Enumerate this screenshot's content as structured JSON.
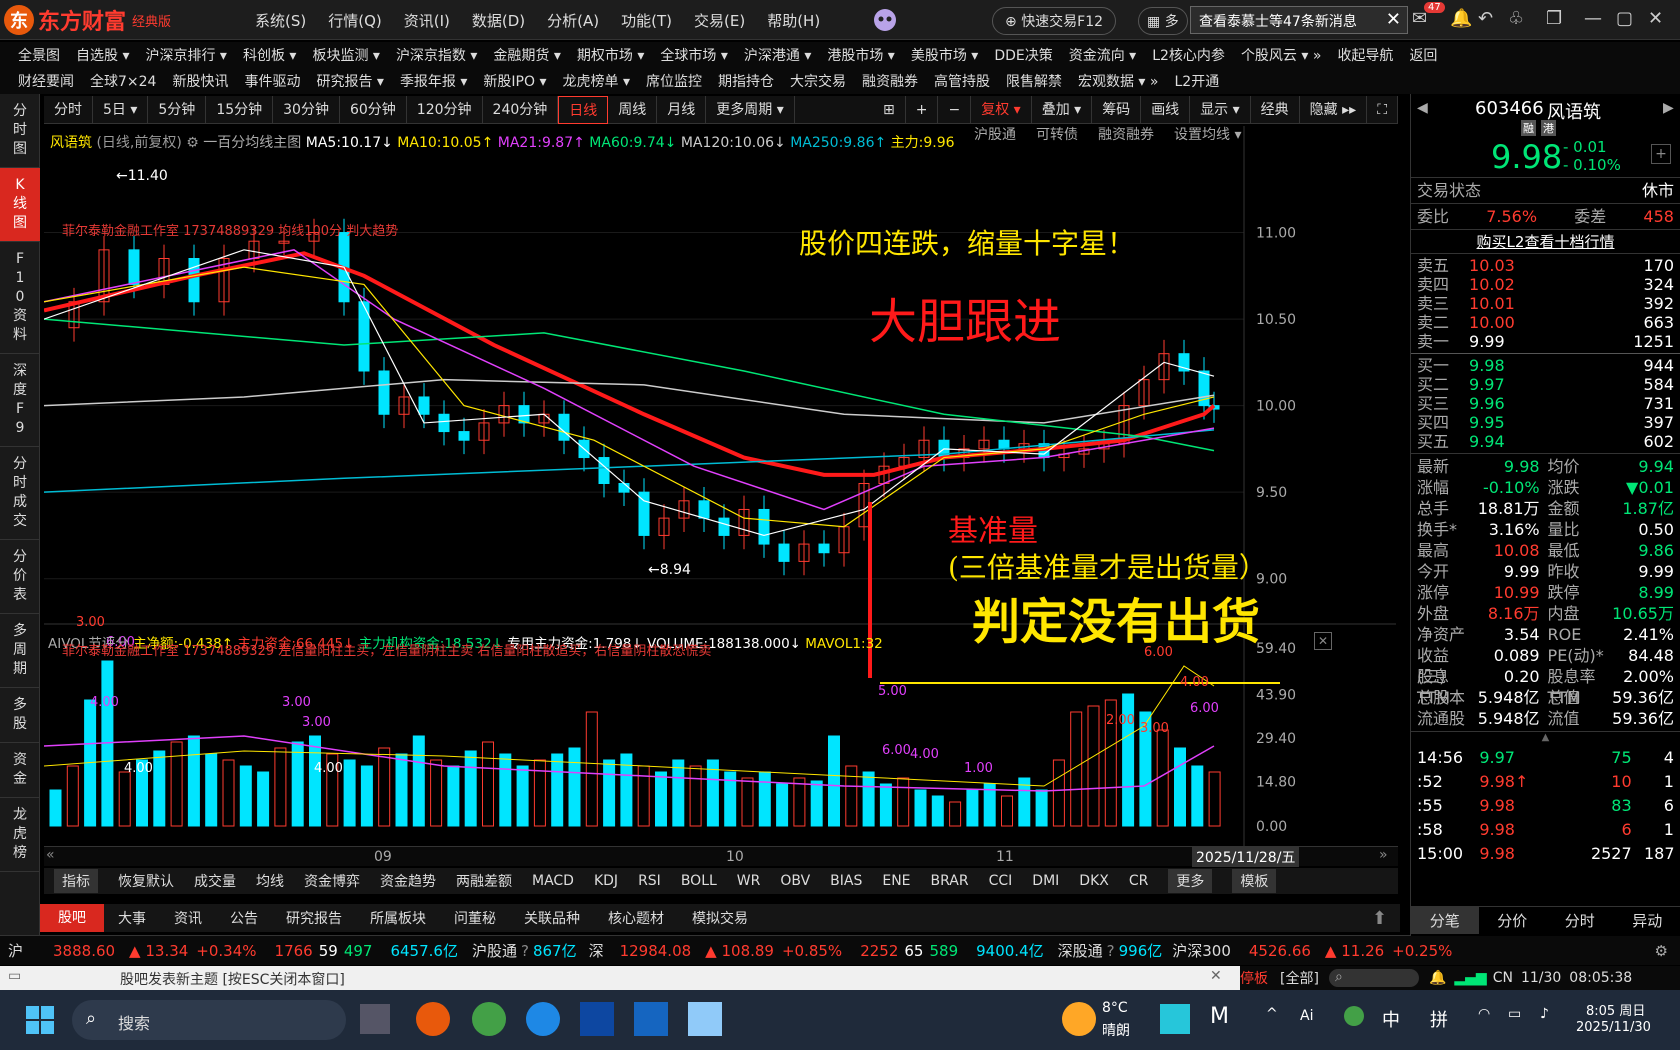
{
  "app": {
    "brand": "东方财富",
    "edition": "经典版"
  },
  "main_menu": [
    "系统(S)",
    "行情(Q)",
    "资讯(I)",
    "数据(D)",
    "分析(A)",
    "功能(T)",
    "交易(E)",
    "帮助(H)"
  ],
  "quick_trade": "快速交易F12",
  "multi_label": "多",
  "news_msg": "查看泰慕士等47条新消息",
  "mail_count": "47",
  "menu_row1": [
    "全景图",
    "自选股 ▾",
    "沪深京排行 ▾",
    "科创板 ▾",
    "板块监测 ▾",
    "沪深京指数 ▾",
    "金融期货 ▾",
    "期权市场 ▾",
    "全球市场 ▾",
    "沪深港通 ▾",
    "港股市场 ▾",
    "美股市场 ▾",
    "DDE决策",
    "资金流向 ▾",
    "L2核心内参",
    "个股风云 ▾ »",
    "收起导航",
    "返回"
  ],
  "menu_row2": [
    "财经要闻",
    "全球7×24",
    "新股快讯",
    "事件驱动",
    "研究报告 ▾",
    "季报年报 ▾",
    "新股IPO ▾",
    "龙虎榜单 ▾",
    "席位监控",
    "期指持仓",
    "大宗交易",
    "融资融券",
    "高管持股",
    "限售解禁",
    "宏观数据 ▾ »",
    "L2开通"
  ],
  "left_sidebar": [
    "分时图",
    "K线图",
    "F10资料",
    "深度F9",
    "分时成交",
    "分价表",
    "多周期",
    "多股",
    "资金",
    "龙虎榜"
  ],
  "period_tabs": [
    "分时",
    "5日 ▾",
    "5分钟",
    "15分钟",
    "30分钟",
    "60分钟",
    "120分钟",
    "240分钟",
    "日线",
    "周线",
    "月线",
    "更多周期 ▾"
  ],
  "period_active": "日线",
  "chart_tools": [
    "⊞",
    "+",
    "−",
    "复权 ▾",
    "叠加 ▾",
    "筹码",
    "画线",
    "显示 ▾",
    "经典",
    "隐藏 ▸▸",
    "⛶"
  ],
  "ma_legend": {
    "stock": "风语筑",
    "mode": "(日线,前复权)",
    "indicator": "一百分均线主图",
    "ma5": "MA5:10.17↓",
    "ma10": "MA10:10.05↑",
    "ma21": "MA21:9.87↑",
    "ma60": "MA60:9.74↓",
    "ma120": "MA120:10.06↓",
    "ma250": "MA250:9.86↑",
    "zhuli": "主力:9.96",
    "links": [
      "沪股通",
      "可转债",
      "融资融券",
      "设置均线 ▾"
    ]
  },
  "studio_line_top": "菲尔泰勒金融工作室 17374889329 均线100分 判大趋势",
  "studio_line_vol": "菲尔泰勒金融工作室 17374889329  左信量阳柱主买，左信量阴柱主卖  右信量阳柱散追买，右信量阴柱散恐慌卖",
  "annotations": {
    "a1": "股价四连跌，缩量十字星！",
    "a2": "大胆跟进",
    "a3": "基准量",
    "a4": "(三倍基准量才是出货量）",
    "a5": "判定没有出货"
  },
  "price_marks": {
    "high": "←11.40",
    "low": "←8.94"
  },
  "price_axis": [
    "11.00",
    "10.50",
    "10.00",
    "9.50",
    "9.00"
  ],
  "vol_axis": [
    "59.40",
    "43.90",
    "29.40",
    "14.80",
    "0.00"
  ],
  "date_axis": [
    "09",
    "10",
    "11",
    "2025/11/28/五"
  ],
  "vol_legend": {
    "name": "AIVOL节评分",
    "jinge": "主净额:-0.438↑",
    "zhuli": "主力资金:66.445↓",
    "jigou": "主力机构资金:18.532↓",
    "zhuanyong": "专用主力资金:1.798↓",
    "volume": "VOLUME:188138.000↓",
    "mavol": "MAVOL1:32"
  },
  "vol_labels": [
    "3.00",
    "6.00",
    "4.00",
    "4.00",
    "3.00",
    "3.00",
    "5.00",
    "6.00",
    "4.00",
    "1.00",
    "2.00",
    "3.00",
    "6.00",
    "4.00",
    "6.00",
    "4.00"
  ],
  "indicator_tabs": [
    "指标",
    "恢复默认",
    "成交量",
    "均线",
    "资金博弈",
    "资金趋势",
    "两融差额",
    "MACD",
    "KDJ",
    "RSI",
    "BOLL",
    "WR",
    "OBV",
    "BIAS",
    "ENE",
    "BRAR",
    "CCI",
    "DMI",
    "DKX",
    "CR",
    "更多",
    "模板"
  ],
  "news_tabs": [
    "股吧",
    "大事",
    "资讯",
    "公告",
    "研究报告",
    "所属板块",
    "问董秘",
    "关联品种",
    "核心题材",
    "模拟交易"
  ],
  "ticker": {
    "sh_label": "沪",
    "sh": "3888.60",
    "sh_chg": "▲ 13.34",
    "sh_pct": "+0.34%",
    "sh_up": "1766",
    "sh_flat": "59",
    "sh_dn": "497",
    "sh_amt": "6457.6亿",
    "hgt_label": "沪股通",
    "hgt": "867亿",
    "sz_label": "深",
    "sz": "12984.08",
    "sz_chg": "▲ 108.89",
    "sz_pct": "+0.85%",
    "sz_up": "2252",
    "sz_flat": "65",
    "sz_dn": "589",
    "sz_amt": "9400.4亿",
    "sgt_label": "深股通",
    "sgt": "996亿",
    "hs300_label": "沪深300",
    "hs300": "4526.66",
    "hs300_chg": "▲ 11.26",
    "hs300_pct": "+0.25%"
  },
  "post_bar": "股吧发表新主题 [按ESC关闭本窗口]",
  "post_right": [
    "停板",
    "[全部]",
    "CN",
    "11/30",
    "08:05:38"
  ],
  "quote": {
    "code": "603466",
    "name": "风语筑",
    "tags": [
      "融",
      "港"
    ],
    "price": "9.98",
    "chg": "- 0.01",
    "pct": "- 0.10%",
    "status_label": "交易状态",
    "status": "休市",
    "weibi_label": "委比",
    "weibi": "7.56%",
    "weicha_label": "委差",
    "weicha": "458",
    "l2_link": "购买L2查看十档行情",
    "asks": [
      {
        "label": "卖五",
        "price": "10.03",
        "vol": "170"
      },
      {
        "label": "卖四",
        "price": "10.02",
        "vol": "324"
      },
      {
        "label": "卖三",
        "price": "10.01",
        "vol": "392"
      },
      {
        "label": "卖二",
        "price": "10.00",
        "vol": "663"
      },
      {
        "label": "卖一",
        "price": "9.99",
        "vol": "1251"
      }
    ],
    "bids": [
      {
        "label": "买一",
        "price": "9.98",
        "vol": "944"
      },
      {
        "label": "买二",
        "price": "9.97",
        "vol": "584"
      },
      {
        "label": "买三",
        "price": "9.96",
        "vol": "731"
      },
      {
        "label": "买四",
        "price": "9.95",
        "vol": "397"
      },
      {
        "label": "买五",
        "price": "9.94",
        "vol": "602"
      }
    ],
    "stats": [
      [
        "最新",
        "9.98",
        "均价",
        "9.94"
      ],
      [
        "涨幅",
        "-0.10%",
        "涨跌",
        "▼0.01"
      ],
      [
        "总手",
        "18.81万",
        "金额",
        "1.87亿"
      ],
      [
        "换手*",
        "3.16%",
        "量比",
        "0.50"
      ],
      [
        "最高",
        "10.08",
        "最低",
        "9.86"
      ],
      [
        "今开",
        "9.99",
        "昨收",
        "9.99"
      ],
      [
        "涨停",
        "10.99",
        "跌停",
        "8.99"
      ],
      [
        "外盘",
        "8.16万",
        "内盘",
        "10.65万"
      ],
      [
        "净资产",
        "3.54",
        "ROE",
        "2.41%"
      ],
      [
        "收益(三)",
        "0.089",
        "PE(动)*",
        "84.48"
      ],
      [
        "股息TTM",
        "0.20",
        "股息率TTM",
        "2.00%"
      ],
      [
        "总股本",
        "5.948亿",
        "总值",
        "59.36亿"
      ],
      [
        "流通股",
        "5.948亿",
        "流值",
        "59.36亿"
      ]
    ],
    "ticks": [
      {
        "time": "14:56",
        "price": "9.97",
        "vol": "75",
        "n": "4"
      },
      {
        "time": ":52",
        "price": "9.98↑",
        "vol": "10",
        "n": "1"
      },
      {
        "time": ":55",
        "price": "9.98",
        "vol": "83",
        "n": "6"
      },
      {
        "time": ":58",
        "price": "9.98",
        "vol": "6",
        "n": "1"
      },
      {
        "time": "15:00",
        "price": "9.98",
        "vol": "2527",
        "n": "187"
      }
    ],
    "bottom_tabs": [
      "分笔",
      "分价",
      "分时",
      "异动"
    ]
  },
  "taskbar": {
    "search": "搜索",
    "weather_temp": "8°C",
    "weather_desc": "晴朗",
    "time": "8:05 周日",
    "date": "2025/11/30",
    "ime": "中",
    "ime2": "拼"
  }
}
